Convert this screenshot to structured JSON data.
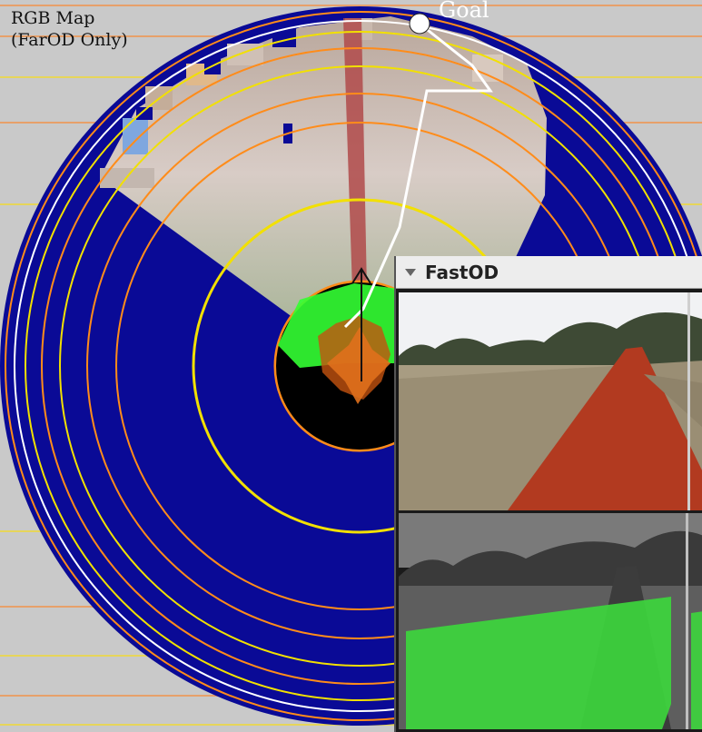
{
  "map": {
    "title_line1": "RGB Map",
    "title_line2": "(FarOD Only)",
    "goal_label": "Goal",
    "colors": {
      "unknown": "#0a0a96",
      "ring_orange": "#ff8c1a",
      "ring_yellow": "#f2e000",
      "path": "#ffffff",
      "traversable": "#33ff33",
      "robot_zone": "#000000",
      "obstacle": "#c4520f"
    }
  },
  "panel": {
    "title": "FastOD",
    "toggle_icon": "triangle-down-icon",
    "top_image": "camera-rgb-view",
    "bottom_image": "traversability-overlay-view"
  }
}
